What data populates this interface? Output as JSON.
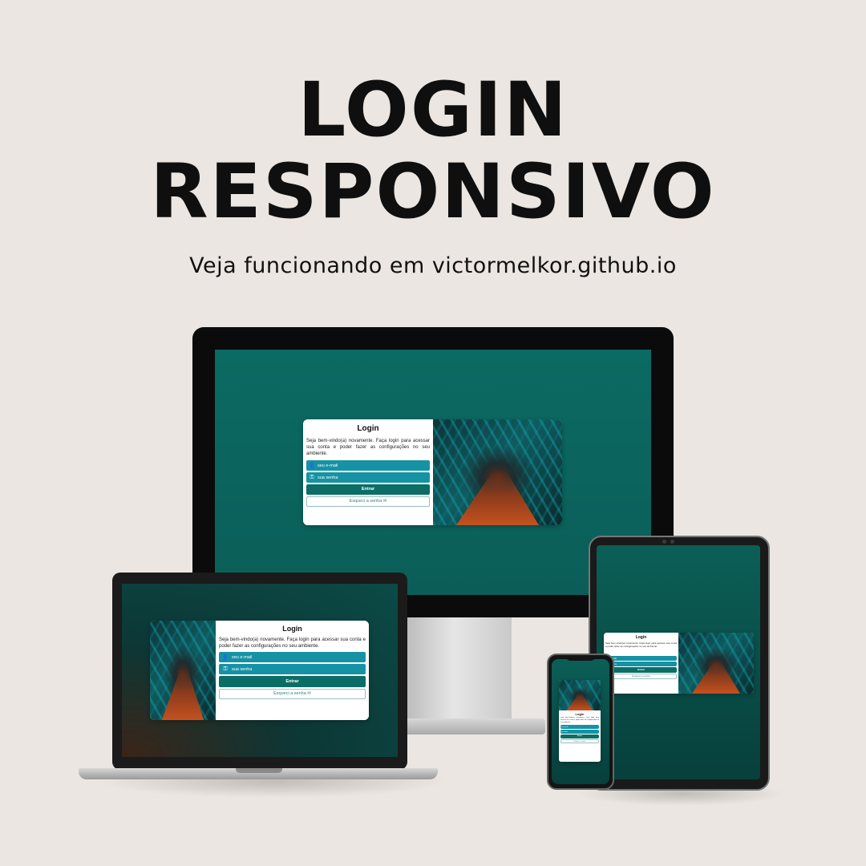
{
  "headline": {
    "line1": "LOGIN",
    "line2": "RESPONSIVO"
  },
  "subtitle": "Veja funcionando em victormelkor.github.io",
  "login_card": {
    "title": "Login",
    "description": "Seja bem-vindo(a) novamente. Faça login para acessar sua conta e poder fazer as configurações no seu ambiente.",
    "email_placeholder": "seu e-mail",
    "password_placeholder": "sua senha",
    "submit_label": "Entrar",
    "forgot_label": "Esqueci a senha",
    "forgot_icon": "✉",
    "user_icon": "👤",
    "key_icon": "⚿"
  },
  "colors": {
    "background": "#ebe6e1",
    "screen_teal": "#0b6a63",
    "field_teal": "#1593a5",
    "button_teal": "#0b6e66"
  }
}
